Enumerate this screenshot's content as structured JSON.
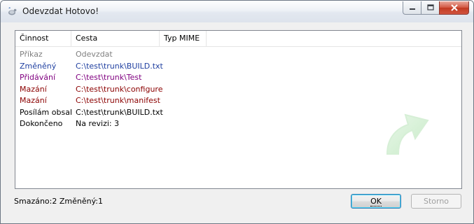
{
  "window": {
    "title": "Odevzdat Hotovo!"
  },
  "colors": {
    "header_row": "#808080",
    "modified": "#1f3fa0",
    "added": "#800080",
    "deleted": "#8b0000",
    "normal": "#000000"
  },
  "list": {
    "columns": [
      "Činnost",
      "Cesta",
      "Typ MIME"
    ],
    "rows": [
      {
        "action": "Příkaz",
        "path": "Odevzdat",
        "color": "#808080"
      },
      {
        "action": "Změněný",
        "path": "C:\\test\\trunk\\BUILD.txt",
        "color": "#1f3fa0"
      },
      {
        "action": "Přidávání",
        "path": "C:\\test\\trunk\\Test",
        "color": "#800080"
      },
      {
        "action": "Mazání",
        "path": "C:\\test\\trunk\\configure",
        "color": "#8b0000"
      },
      {
        "action": "Mazání",
        "path": "C:\\test\\trunk\\manifest",
        "color": "#8b0000"
      },
      {
        "action": "Posílám obsah",
        "path": "C:\\test\\trunk\\BUILD.txt",
        "color": "#000000"
      },
      {
        "action": "Dokončeno",
        "path": "Na revizi: 3",
        "color": "#000000"
      }
    ]
  },
  "status": {
    "summary": "Smazáno:2 Změněný:1"
  },
  "buttons": {
    "ok": "OK",
    "cancel": "Storno"
  },
  "icons": {
    "app": "tortoise-icon",
    "watermark": "commit-arrow-icon",
    "minimize": "minimize-icon",
    "maximize": "maximize-icon",
    "close": "close-icon"
  }
}
